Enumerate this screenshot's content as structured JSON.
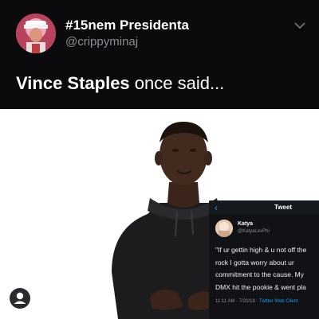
{
  "tweet": {
    "display_name": "#15nem Presidenta",
    "handle": "@crippyminaj",
    "text_strong": "Vince Staples",
    "text_rest": " once said..."
  },
  "media": {
    "embedded_tweet": {
      "back_icon": "chevron-left-icon",
      "header_title": "Tweet",
      "author_name": "Katya",
      "author_handle": "@KatyaLevPhi",
      "body_lines": [
        "\"If ur gettin high & u not off the",
        "rock I gotta worry about ur",
        "commitment to the cause. My",
        "DMX hit the pookie & went pla"
      ],
      "meta_time": "11:11 AM · 7/20/18 · ",
      "meta_client": "Twitter Web Client"
    },
    "profile_icon": "person-circle-icon"
  },
  "colors": {
    "header_bg": "#0b0b0d",
    "handle_gray": "#8a8d93",
    "link_blue": "#1d9bf0"
  }
}
